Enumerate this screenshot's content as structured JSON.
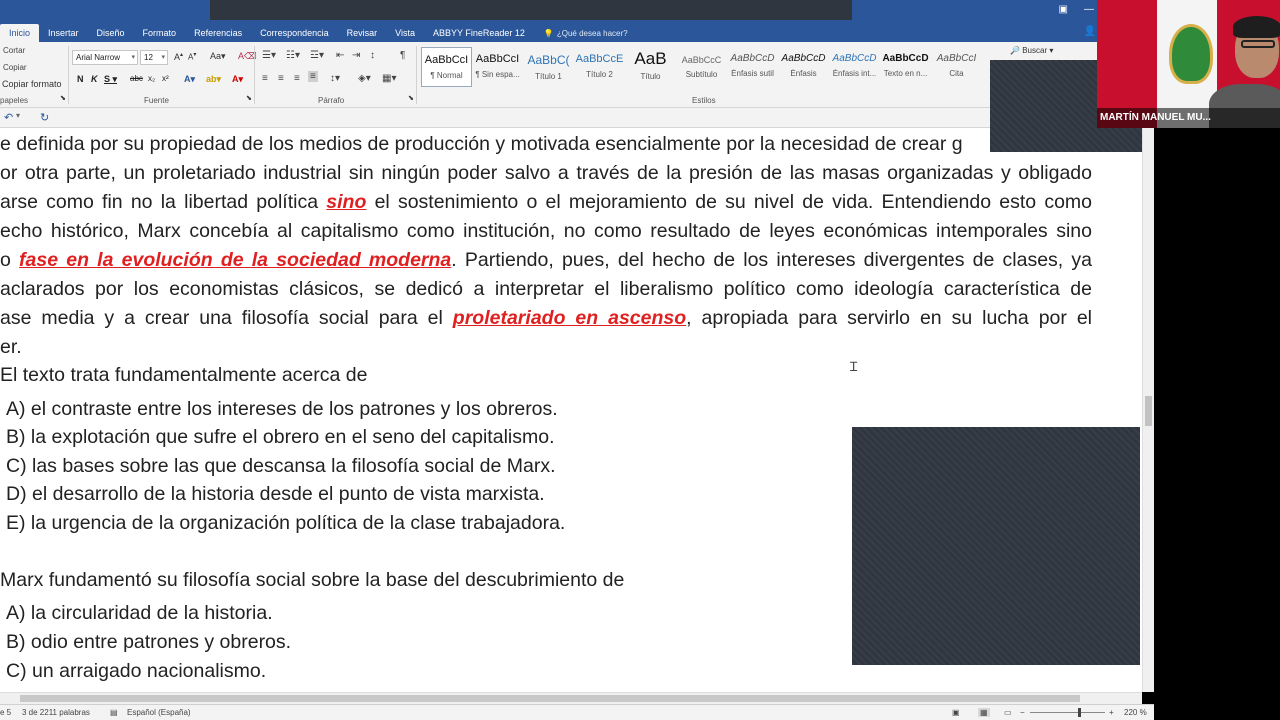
{
  "tabs": [
    "Inicio",
    "Insertar",
    "Diseño",
    "Formato",
    "Referencias",
    "Correspondencia",
    "Revisar",
    "Vista",
    "ABBYY FineReader 12"
  ],
  "tell_me": "¿Qué desea hacer?",
  "clipboard": {
    "cut": "Cortar",
    "copy": "Copiar",
    "format_painter": "Copiar formato",
    "label": "papeles"
  },
  "font": {
    "name": "Arial Narrow",
    "size": "12",
    "label": "Fuente"
  },
  "paragraph_label": "Párrafo",
  "styles_label": "Estilos",
  "styles": [
    {
      "sample": "AaBbCcI",
      "name": "¶ Normal"
    },
    {
      "sample": "AaBbCcI",
      "name": "¶ Sin espa..."
    },
    {
      "sample": "AaBbC(",
      "name": "Título 1"
    },
    {
      "sample": "AaBbCcE",
      "name": "Título 2"
    },
    {
      "sample": "AaB",
      "name": "Título"
    },
    {
      "sample": "AaBbCcC",
      "name": "Subtítulo"
    },
    {
      "sample": "AaBbCcD",
      "name": "Énfasis sutil"
    },
    {
      "sample": "AaBbCcD",
      "name": "Énfasis"
    },
    {
      "sample": "AaBbCcD",
      "name": "Énfasis int..."
    },
    {
      "sample": "AaBbCcD",
      "name": "Texto en n..."
    },
    {
      "sample": "AaBbCcI",
      "name": "Cita"
    }
  ],
  "search_label": "Buscar",
  "document": {
    "l1": "e definida por su propiedad de los medios de producción y motivada esencialmente por la necesidad de crear g",
    "l2": "or otra parte, un proletariado industrial sin ningún poder salvo a través de la presión de las masas organizadas y obligado",
    "l3a": "arse como fin no la libertad política ",
    "l3hl": "sino",
    "l3b": " el sostenimiento o el mejoramiento de su nivel de vida. Entendiendo esto como",
    "l4": "echo histórico, Marx concebía al capitalismo como institución, no como resultado de leyes económicas intemporales sino",
    "l5a": "o ",
    "l5hl": "fase en la evolución de la sociedad moderna",
    "l5b": ". Partiendo, pues, del hecho de los intereses divergentes de clases, ya",
    "l6": " aclarados por los economistas clásicos, se dedicó a interpretar el liberalismo político como ideología característica de",
    "l7a": "ase media y a crear una filosofía social para el ",
    "l7hl": "proletariado en ascenso",
    "l7b": ", apropiada para servirlo en su lucha por el",
    "l8": "er.",
    "q1": "El texto trata fundamentalmente acerca de",
    "q1_options": [
      "A) el contraste entre los intereses de los patrones y los obreros.",
      "B) la explotación que sufre el obrero en el seno del capitalismo.",
      "C) las bases sobre las que descansa la filosofía social de Marx.",
      "D) el desarrollo de la historia desde el punto de vista marxista.",
      "E) la urgencia de la organización política de la clase trabajadora."
    ],
    "q2": "Marx fundamentó su filosofía social sobre la base del descubrimiento de",
    "q2_options": [
      "A) la circularidad de la historia.",
      "B) odio entre patrones y obreros.",
      "C) un arraigado nacionalismo."
    ]
  },
  "status": {
    "page": "e 5",
    "words": "3 de 2211 palabras",
    "language": "Español (España)",
    "zoom": "220 %"
  },
  "webcam": {
    "name": "MARTÍN MANUEL MU..."
  },
  "colors": {
    "ribbon_blue": "#2b579a",
    "highlight_red": "#e02020"
  }
}
